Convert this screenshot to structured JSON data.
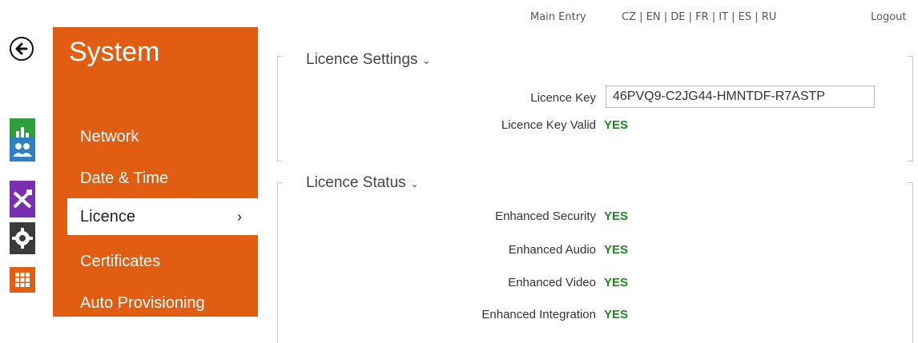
{
  "topbar": {
    "main_entry": "Main Entry",
    "languages": "CZ | EN | DE | FR | IT | ES | RU",
    "logout": "Logout"
  },
  "menu": {
    "title": "System",
    "items": [
      {
        "label": "Network"
      },
      {
        "label": "Date & Time"
      },
      {
        "label": "Licence",
        "active": true
      },
      {
        "label": "Certificates"
      },
      {
        "label": "Auto Provisioning"
      }
    ],
    "active_chevron": "›"
  },
  "icons": [
    "back-arrow-icon",
    "status-chart-icon",
    "users-icon",
    "tools-icon",
    "gear-icon",
    "grid-icon"
  ],
  "licence_settings": {
    "title": "Licence Settings",
    "caret": "⌄",
    "key_label": "Licence Key",
    "key_value": "46PVQ9-C2JG44-HMNTDF-R7ASTP",
    "valid_label": "Licence Key Valid",
    "valid_value": "YES"
  },
  "licence_status": {
    "title": "Licence Status",
    "caret": "⌄",
    "rows": [
      {
        "label": "Enhanced Security",
        "value": "YES"
      },
      {
        "label": "Enhanced Audio",
        "value": "YES"
      },
      {
        "label": "Enhanced Video",
        "value": "YES"
      },
      {
        "label": "Enhanced Integration",
        "value": "YES"
      }
    ]
  },
  "colors": {
    "accent": "#e05d12",
    "ok": "#1e8a1e"
  }
}
